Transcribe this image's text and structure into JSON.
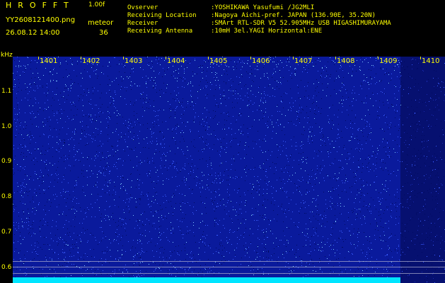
{
  "header": {
    "app_title": "HROFFT",
    "version": "1.00f",
    "filename": "YY2608121400.png",
    "mode": "meteor",
    "datetime": "26.08.12 14:00",
    "count": "36",
    "info": [
      {
        "label": "Ovserver",
        "value": ":YOSHIKAWA Yasufumi /JG2MLI"
      },
      {
        "label": "Receiving Location",
        "value": ":Nagoya Aichi-pref. JAPAN (136.90E, 35.20N)"
      },
      {
        "label": "Receiver",
        "value": ":SMArt RTL-SDR V5 52.905MHz USB HIGASHIMURAYAMA"
      },
      {
        "label": "Receiving Antenna",
        "value": ":10mH 3el.YAGI Horizontal:ENE"
      }
    ]
  },
  "y_axis": {
    "unit": "kHz",
    "ticks": [
      "1.1",
      "1.0",
      "0.9",
      "0.8",
      "0.7",
      "0.6"
    ]
  },
  "x_axis": {
    "minute_labels": [
      "1401",
      "1402",
      "1403",
      "1404",
      "1405",
      "1406",
      "1407",
      "1408",
      "1409",
      "1410"
    ]
  },
  "colors": {
    "background": "#000000",
    "text": "#ffff00",
    "spectrogram_base": "#0a1a9c",
    "noise_light": "#3a5cff",
    "noise_bright": "#7fc8ff",
    "noise_dark": "#000a60",
    "baseline": "#00e5ff"
  }
}
